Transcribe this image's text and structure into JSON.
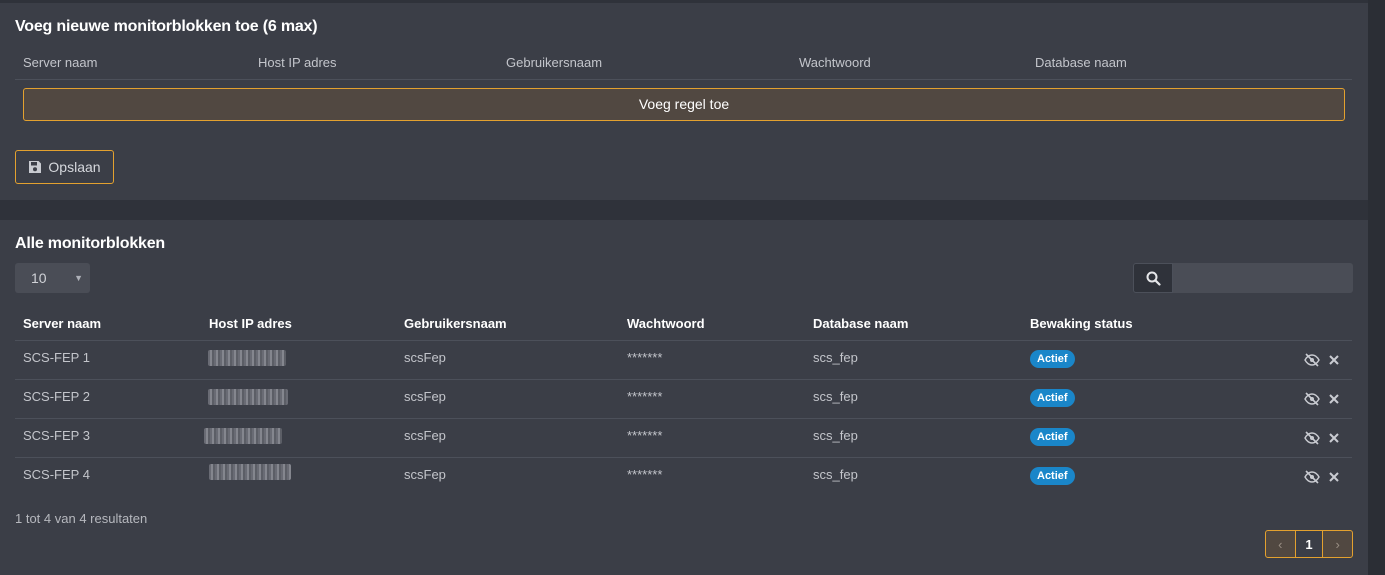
{
  "add_section": {
    "title": "Voeg nieuwe monitorblokken toe (6 max)",
    "columns": [
      "Server naam",
      "Host IP adres",
      "Gebruikersnaam",
      "Wachtwoord",
      "Database naam"
    ],
    "add_row_label": "Voeg regel toe",
    "save_label": "Opslaan"
  },
  "list_section": {
    "title": "Alle monitorblokken",
    "page_size": "10",
    "search_placeholder": "",
    "columns": [
      "Server naam",
      "Host IP adres",
      "Gebruikersnaam",
      "Wachtwoord",
      "Database naam",
      "Bewaking status"
    ],
    "rows": [
      {
        "server": "SCS-FEP 1",
        "ip": "172.16.8.18",
        "user": "scsFep",
        "password": "*******",
        "database": "scs_fep",
        "status": "Actief"
      },
      {
        "server": "SCS-FEP 2",
        "ip": "172.16.8.20",
        "user": "scsFep",
        "password": "*******",
        "database": "scs_fep",
        "status": "Actief"
      },
      {
        "server": "SCS-FEP 3",
        "ip": "172.16.8.17",
        "user": "scsFep",
        "password": "*******",
        "database": "scs_fep",
        "status": "Actief"
      },
      {
        "server": "SCS-FEP 4",
        "ip": "172.16.8.19",
        "user": "scsFep",
        "password": "*******",
        "database": "scs_fep",
        "status": "Actief"
      }
    ],
    "result_summary": "1 tot 4 van 4 resultaten",
    "pagination": {
      "current_page": "1",
      "prev": "‹",
      "next": "›"
    }
  },
  "colors": {
    "accent": "#e3a12f",
    "badge": "#1a86c9",
    "panel": "#3b3e47",
    "background": "#2f323a"
  }
}
